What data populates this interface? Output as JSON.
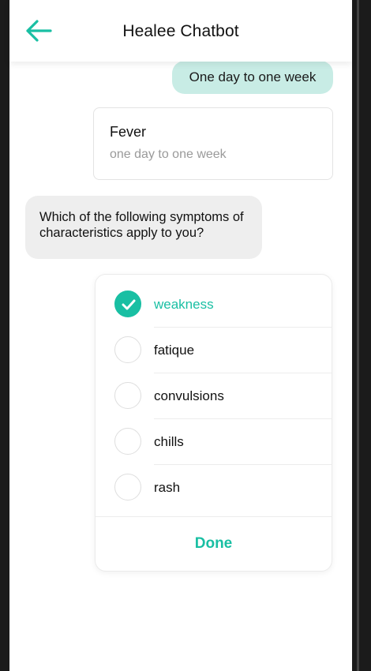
{
  "header": {
    "title": "Healee Chatbot"
  },
  "messages": {
    "user_reply": "One day to one week",
    "summary_card": {
      "title": "Fever",
      "subtitle": "one day to one week"
    },
    "bot_question": "Which of the following symptoms of characteristics apply to you?"
  },
  "symptom_options": [
    {
      "label": "weakness",
      "selected": true
    },
    {
      "label": "fatique",
      "selected": false
    },
    {
      "label": "convulsions",
      "selected": false
    },
    {
      "label": "chills",
      "selected": false
    },
    {
      "label": "rash",
      "selected": false
    }
  ],
  "done_label": "Done",
  "colors": {
    "accent": "#19bfa3",
    "user_bubble": "#c8ece5",
    "bot_bubble": "#eeeeee"
  }
}
